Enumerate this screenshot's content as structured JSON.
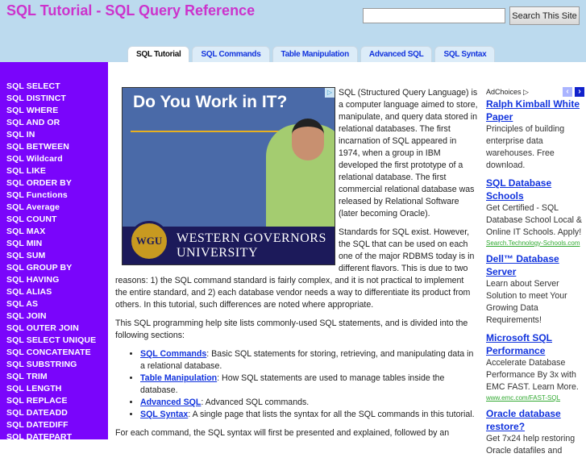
{
  "header": {
    "title": "SQL Tutorial - SQL Query Reference",
    "search_placeholder": "",
    "search_button": "Search This Site"
  },
  "tabs": [
    {
      "label": "SQL Tutorial",
      "active": true
    },
    {
      "label": "SQL Commands"
    },
    {
      "label": "Table Manipulation"
    },
    {
      "label": "Advanced SQL"
    },
    {
      "label": "SQL Syntax"
    }
  ],
  "sidebar": [
    "SQL SELECT",
    "SQL DISTINCT",
    "SQL WHERE",
    "SQL AND OR",
    "SQL IN",
    "SQL BETWEEN",
    "SQL Wildcard",
    "SQL LIKE",
    "SQL ORDER BY",
    "SQL Functions",
    "SQL Average",
    "SQL COUNT",
    "SQL MAX",
    "SQL MIN",
    "SQL SUM",
    "SQL GROUP BY",
    "SQL HAVING",
    "SQL ALIAS",
    "SQL AS",
    "SQL JOIN",
    "SQL OUTER JOIN",
    "SQL SELECT UNIQUE",
    "SQL CONCATENATE",
    "SQL SUBSTRING",
    "SQL TRIM",
    "SQL LENGTH",
    "SQL REPLACE",
    "SQL DATEADD",
    "SQL DATEDIFF",
    "SQL DATEPART"
  ],
  "banner": {
    "headline": "Do You Work in IT?",
    "seal": "WGU",
    "university": "WESTERN GOVERNORS UNIVERSITY",
    "badge": "▷"
  },
  "main": {
    "p1": "SQL (Structured Query Language) is a computer language aimed to store, manipulate, and query data stored in relational databases. The first incarnation of SQL appeared in 1974, when a group in IBM developed the first prototype of a relational database. The first commercial relational database was released by Relational Software (later becoming Oracle).",
    "p2": "Standards for SQL exist. However, the SQL that can be used on each one of the major RDBMS today is in different flavors. This is due to two reasons: 1) the SQL command standard is fairly complex, and it is not practical to implement the entire standard, and 2) each database vendor needs a way to differentiate its product from others. In this tutorial, such differences are noted where appropriate.",
    "p3": "This SQL programming help site lists commonly-used SQL statements, and is divided into the following sections:",
    "sections": [
      {
        "link": "SQL Commands",
        "desc": ": Basic SQL statements for storing, retrieving, and manipulating data in a relational database."
      },
      {
        "link": "Table Manipulation",
        "desc": ": How SQL statements are used to manage tables inside the database."
      },
      {
        "link": "Advanced SQL",
        "desc": ": Advanced SQL commands."
      },
      {
        "link": "SQL Syntax",
        "desc": ": A single page that lists the syntax for all the SQL commands in this tutorial."
      }
    ],
    "p4": "For each command, the SQL syntax will first be presented and explained, followed by an"
  },
  "ads": {
    "adchoices": "AdChoices ▷",
    "prev": "‹",
    "next": "›",
    "items": [
      {
        "title": "Ralph Kimball White Paper",
        "text": "Principles of building enterprise data warehouses. Free download.",
        "url": ""
      },
      {
        "title": "SQL Database Schools",
        "text": "Get Certified - SQL Database School Local & Online IT Schools. Apply!",
        "url": "Search.Technology-Schools.com"
      },
      {
        "title": "Dell™ Database Server",
        "text": "Learn about Server Solution to meet Your Growing Data Requirements!",
        "url": ""
      },
      {
        "title": "Microsoft SQL Performance",
        "text": "Accelerate Database Performance By 3x with EMC FAST. Learn More.",
        "url": "www.emc.com/FAST-SQL"
      },
      {
        "title": "Oracle database restore?",
        "text": "Get 7x24 help restoring Oracle datafiles and",
        "url": ""
      }
    ]
  }
}
